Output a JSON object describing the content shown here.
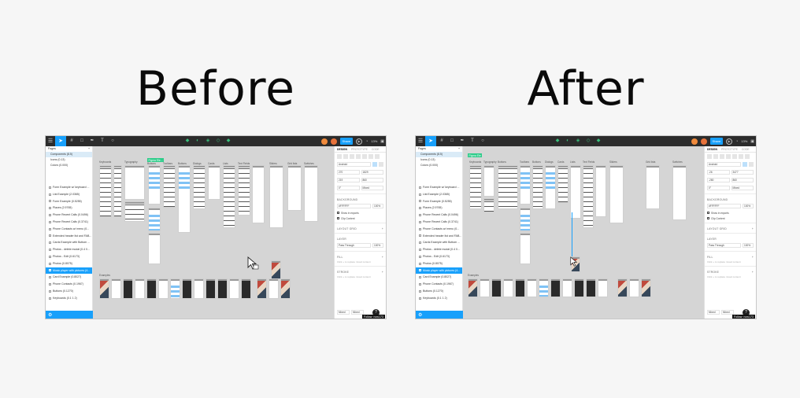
{
  "headings": {
    "before": "Before",
    "after": "After"
  },
  "toolbar": {
    "share_label": "Share",
    "zoom_label": "13%",
    "left_tools": [
      "frame-icon",
      "shape-icon",
      "pen-icon",
      "text-icon",
      "comment-icon"
    ],
    "center_tools": [
      "component-icon",
      "mask-icon",
      "boolean-icon",
      "crop-icon",
      "plugin-icon"
    ]
  },
  "pages": {
    "header": "Pages",
    "items": [
      "Components (8.5)",
      "Icons (0.13)",
      "Colors (0.000)"
    ]
  },
  "layers": [
    "Form Example w/ keyboard ...",
    "List Example (2.0365)",
    "Form Example (0.5255)",
    "Places (2.9765)",
    "Phone Recent Calls (0.0496)",
    "Phone Recent Calls (0.3741)",
    "Phone Contacts w/ menu (0...",
    "Extended header list and FAB...",
    "Cards Example with Bottom ...",
    "Photos - delete modal (0.4 0...",
    "Photos - Edit (0.6173)",
    "Photos (0.8075)",
    "Music player with pictures (4...",
    "Card Example (0.8027)",
    "Phone Contacts (0.1967)",
    "Buttons (0.1270)",
    "Keyboards (0.1 1 2)"
  ],
  "right_panel": {
    "tabs": [
      "DESIGN",
      "PROTOTYPE",
      "CODE"
    ],
    "device": "Android",
    "x": "270",
    "w": "1829",
    "y": "219",
    "h": "860",
    "x_after": "-26",
    "w_after": "3477",
    "y_after": "-280",
    "h_after": "860",
    "rotation": "0°",
    "constraint": "Mixed",
    "background_label": "Background",
    "bg_color": "#FFFFFF",
    "bg_opacity": "100%",
    "show_in_exports": "Show in exports",
    "clip_content": "Clip Content",
    "layout_grid": "Layout Grid",
    "layer_label": "Layer",
    "blend": "Pass Through",
    "layer_opacity": "100%",
    "fill_label": "Fill",
    "fill_hint": "Click + to replace mixed content",
    "stroke_label": "Stroke",
    "stroke_hint": "Click + to replace mixed content",
    "mixed_a": "Mixed",
    "mixed_b": "Mixed",
    "tooltip": "Follow: now173"
  },
  "canvas": {
    "selection_badge_before": "Figma Ele...",
    "selection_badge_after": "Figma Ele",
    "top_labels": [
      "Keyboards",
      "Typography",
      "Buttons",
      "Toolbars",
      "Buttons",
      "Dialogs",
      "Cards",
      "Lists",
      "Text Fields",
      "Sliders",
      "Grid lists",
      "Switches"
    ],
    "bottom_label": "Examples"
  }
}
